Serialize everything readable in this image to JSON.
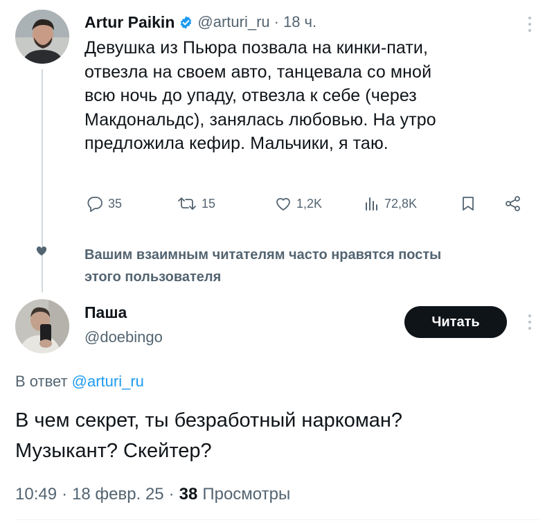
{
  "tweet": {
    "author_name": "Artur Paikin",
    "handle": "@arturi_ru",
    "time_sep": "·",
    "time": "18 ч.",
    "text_lines": [
      "Девушка из Пьюра позвала на кинки-пати,",
      "отвезла на своем авто, танцевала со мной",
      "всю ночь до упаду, отвезла к себе (через",
      "Макдональдс), занялась любовью. На утро",
      "предложила кефир. Мальчики, я таю."
    ],
    "replies": "35",
    "reposts": "15",
    "likes": "1,2K",
    "views": "72,8K",
    "icons": {
      "verified": "verified-badge-icon",
      "more": "more-icon",
      "reply": "reply-icon",
      "repost": "repost-icon",
      "like": "heart-icon",
      "views": "views-icon",
      "bookmark": "bookmark-icon",
      "share": "share-icon"
    }
  },
  "social_context": {
    "line1": "Вашим взаимным читателям часто нравятся посты",
    "line2": "этого пользователя"
  },
  "reply": {
    "author_name": "Паша",
    "handle": "@doebingo",
    "follow_label": "Читать",
    "in_reply_prefix": "В ответ",
    "in_reply_handle": "@arturi_ru",
    "text_lines": [
      "В чем секрет, ты безработный наркоман?",
      "Музыкант? Скейтер?"
    ],
    "time": "10:49",
    "date": "18 февр. 25",
    "sep": "·",
    "views_count": "38",
    "views_label": "Просмотры"
  },
  "colors": {
    "accent": "#1d9bf0",
    "text": "#0f1419",
    "muted": "#536471",
    "line": "#cfd9de"
  }
}
